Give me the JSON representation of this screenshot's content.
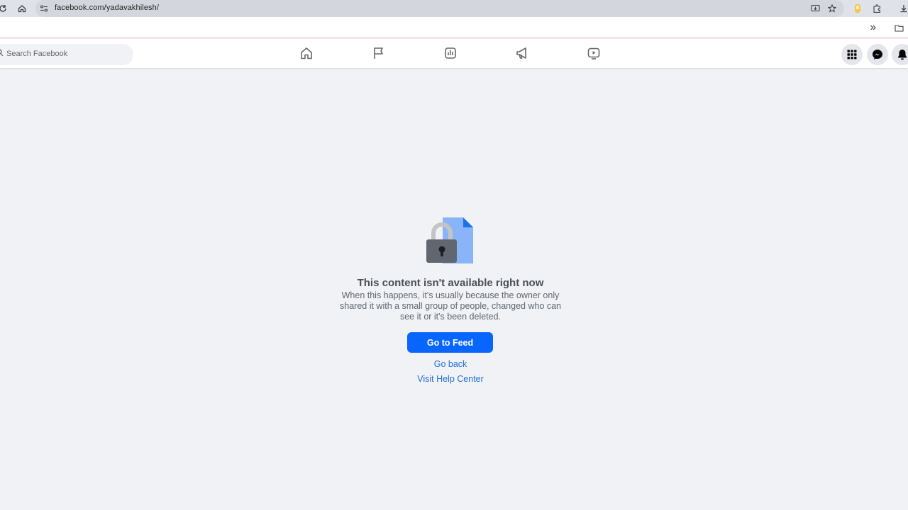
{
  "browser": {
    "url": "facebook.com/yadavakhilesh/",
    "icons": [
      "reload-icon",
      "home-icon",
      "site-info-icon",
      "install-app-icon",
      "bookmark-star-icon",
      "extension-icon",
      "puzzle-icon",
      "download-icon",
      "more-bookmarks-icon",
      "bookmark-folder-icon"
    ]
  },
  "header": {
    "search_placeholder": "Search Facebook",
    "nav_icons": [
      "home-icon",
      "pages-flag-icon",
      "dashboard-icon",
      "ads-megaphone-icon",
      "video-icon"
    ],
    "right_icons": [
      "menu-grid-icon",
      "messenger-icon",
      "notifications-bell-icon"
    ]
  },
  "content": {
    "title": "This content isn't available right now",
    "description": "When this happens, it's usually because the owner only shared it with a small group of people, changed who can see it or it's been deleted.",
    "primary_button": "Go to Feed",
    "link_back": "Go back",
    "link_help": "Visit Help Center"
  },
  "colors": {
    "primary": "#0866ff",
    "link": "#216fdb",
    "background": "#f0f2f5"
  }
}
